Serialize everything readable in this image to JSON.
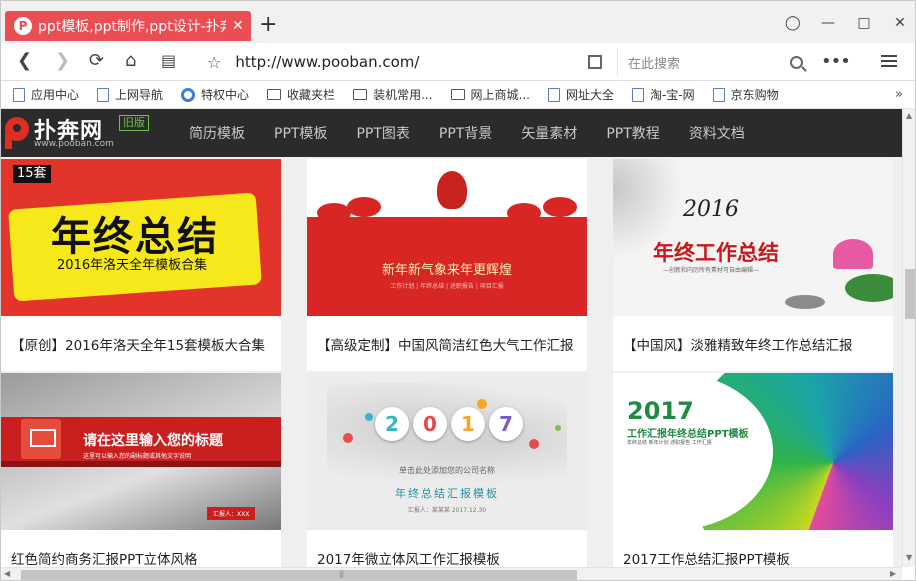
{
  "browser": {
    "tab_title": "ppt模板,ppt制作,ppt设计-扑奔网",
    "tab_logo": "P",
    "tab_close": "✕",
    "new_tab": "+",
    "url": "http://www.pooban.com/",
    "search_placeholder": "在此搜索",
    "more": "•••"
  },
  "bookmarks": [
    {
      "label": "应用中心",
      "icon": "doc-icon"
    },
    {
      "label": "上网导航",
      "icon": "doc-icon"
    },
    {
      "label": "特权中心",
      "icon": "circle-icon"
    },
    {
      "label": "收藏夹栏",
      "icon": "folder-icon"
    },
    {
      "label": "装机常用...",
      "icon": "folder-icon"
    },
    {
      "label": "网上商城...",
      "icon": "folder-icon"
    },
    {
      "label": "网址大全",
      "icon": "doc-icon"
    },
    {
      "label": "淘-宝-网",
      "icon": "doc-icon"
    },
    {
      "label": "京东购物",
      "icon": "doc-icon"
    }
  ],
  "bookmarks_more": "»",
  "site": {
    "name": "扑奔网",
    "domain": "www.pooban.com",
    "old_version": "旧版",
    "nav": [
      "简历模板",
      "PPT模板",
      "PPT图表",
      "PPT背景",
      "矢量素材",
      "PPT教程",
      "资料文档"
    ]
  },
  "cards": [
    {
      "caption": "【原创】2016年洛天全年15套模板大合集",
      "count": "15套",
      "thumb_title": "年终总结",
      "thumb_sub": "2016年洛天全年模板合集"
    },
    {
      "caption": "【高级定制】中国风简洁红色大气工作汇报",
      "thumb_title": "新年新气象来年更辉煌",
      "thumb_sub": "工作计划 | 年终总结 | 述职报告 | 项目汇报"
    },
    {
      "caption": "【中国风】淡雅精致年终工作总结汇报",
      "thumb_year": "2016",
      "thumb_title": "年终工作总结",
      "thumb_sub": "—创新和内历所有素材可自由编辑—"
    },
    {
      "caption": "红色简约商务汇报PPT立体风格",
      "thumb_title": "请在这里输入您的标题",
      "thumb_sub": "这里可以输入您的副标题或其他文字说明",
      "thumb_presenter": "汇报人：XXX"
    },
    {
      "caption": "2017年微立体风工作汇报模板",
      "thumb_digits": [
        "2",
        "0",
        "1",
        "7"
      ],
      "thumb_company": "单击此处添加您的公司名称",
      "thumb_title": "年终总结汇报模板",
      "thumb_meta": "汇报人：某某某     2017.12.30"
    },
    {
      "caption": "2017工作总结汇报PPT模板",
      "thumb_year": "2017",
      "thumb_title": "工作汇报年终总结PPT模板",
      "thumb_sub": "年终总结   新年计划   述职报告   工作汇报"
    }
  ],
  "scroll": {
    "up": "▲",
    "down": "▼",
    "left": "◀",
    "right": "▶",
    "grip": "|||"
  }
}
